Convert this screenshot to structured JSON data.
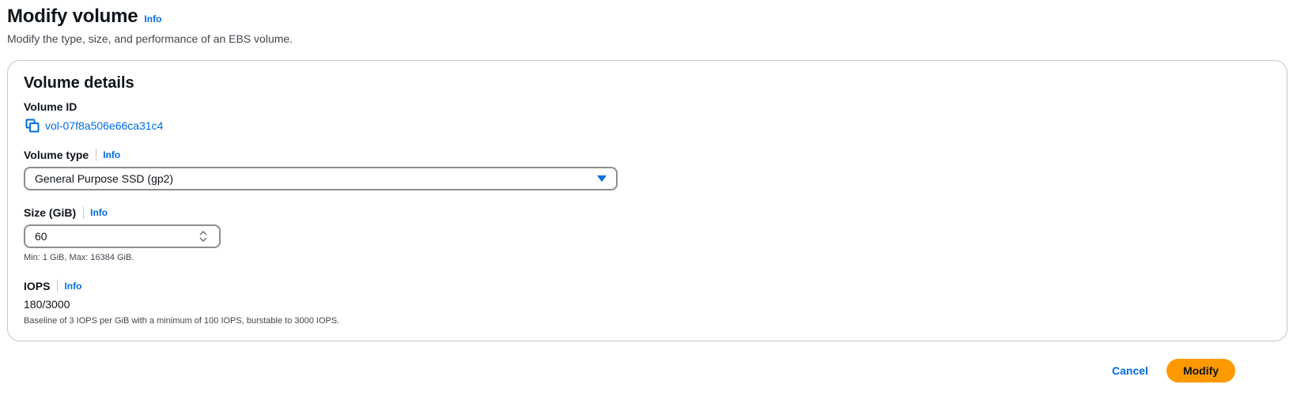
{
  "header": {
    "title": "Modify volume",
    "info_label": "Info",
    "description": "Modify the type, size, and performance of an EBS volume."
  },
  "panel": {
    "title": "Volume details",
    "volume_id": {
      "label": "Volume ID",
      "value": "vol-07f8a506e66ca31c4"
    },
    "volume_type": {
      "label": "Volume type",
      "info_label": "Info",
      "selected": "General Purpose SSD (gp2)"
    },
    "size": {
      "label": "Size (GiB)",
      "info_label": "Info",
      "value": "60",
      "hint": "Min: 1 GiB, Max: 16384 GiB."
    },
    "iops": {
      "label": "IOPS",
      "info_label": "Info",
      "value": "180/3000",
      "hint": "Baseline of 3 IOPS per GiB with a minimum of 100 IOPS, burstable to 3000 IOPS."
    }
  },
  "actions": {
    "cancel_label": "Cancel",
    "modify_label": "Modify"
  },
  "colors": {
    "link": "#006ce0",
    "primary_button": "#ff9900",
    "border": "#c6c6cd",
    "input_border": "#8c8c94"
  },
  "icons": {
    "copy": "copy-icon",
    "caret": "caret-down-icon",
    "stepper": "stepper-icon"
  }
}
